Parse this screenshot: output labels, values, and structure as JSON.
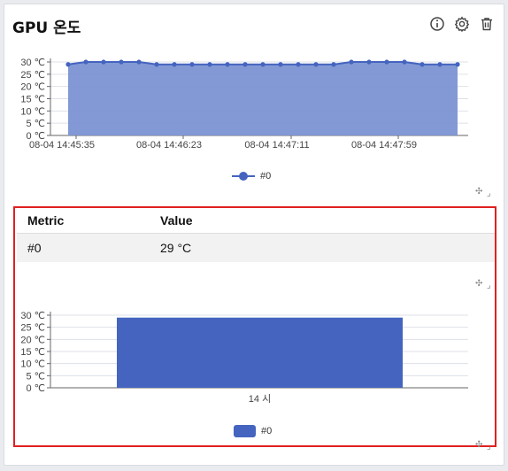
{
  "panel": {
    "title": "GPU 온도",
    "icons": [
      "info-icon",
      "gear-icon",
      "trash-icon"
    ]
  },
  "colors": {
    "series": "#4464bf",
    "area": "#7b93d3",
    "grid": "#dde0ea",
    "highlight": "#e02020"
  },
  "line_chart": {
    "y_ticks": [
      "30 ℃",
      "25 ℃",
      "20 ℃",
      "15 ℃",
      "10 ℃",
      "5 ℃",
      "0 ℃"
    ],
    "x_ticks": [
      "08-04 14:45:35",
      "08-04 14:46:23",
      "08-04 14:47:11",
      "08-04 14:47:59"
    ],
    "legend": "#0"
  },
  "table": {
    "headers": {
      "metric": "Metric",
      "value": "Value"
    },
    "rows": [
      {
        "metric": "#0",
        "value": "29 °C"
      }
    ]
  },
  "bar_chart": {
    "y_ticks": [
      "30 ℃",
      "25 ℃",
      "20 ℃",
      "15 ℃",
      "10 ℃",
      "5 ℃",
      "0 ℃"
    ],
    "x_ticks": [
      "14 시"
    ],
    "legend": "#0"
  },
  "chart_data": [
    {
      "type": "area",
      "title": "",
      "series": [
        {
          "name": "#0",
          "values": [
            29,
            30,
            30,
            30,
            30,
            29,
            29,
            29,
            29,
            29,
            29,
            29,
            29,
            29,
            29,
            29,
            30,
            30,
            30,
            30,
            29,
            29,
            29
          ]
        }
      ],
      "x_tick_labels": [
        "08-04 14:45:35",
        "08-04 14:46:23",
        "08-04 14:47:11",
        "08-04 14:47:59"
      ],
      "ylim": [
        0,
        30
      ],
      "yunit": "℃",
      "grid": true,
      "legend": "bottom"
    },
    {
      "type": "bar",
      "categories": [
        "14 시"
      ],
      "series": [
        {
          "name": "#0",
          "values": [
            29
          ]
        }
      ],
      "ylim": [
        0,
        30
      ],
      "yunit": "℃",
      "grid": true,
      "legend": "bottom"
    }
  ]
}
